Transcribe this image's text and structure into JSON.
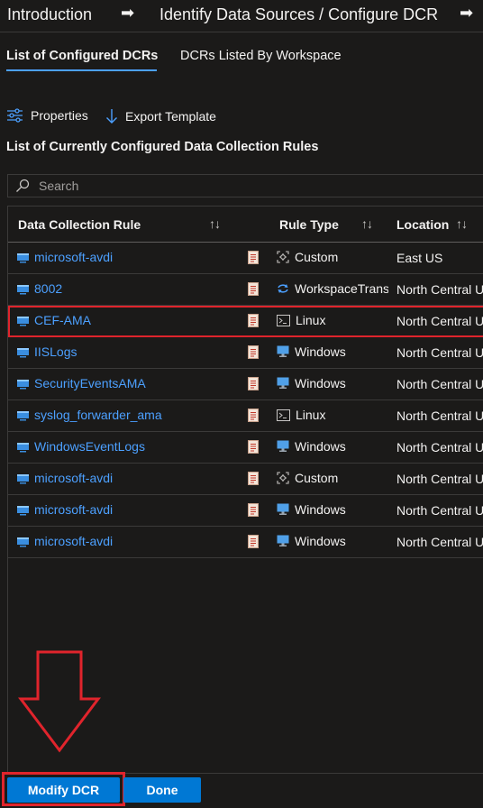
{
  "wizard": {
    "steps": [
      "Introduction",
      "Identify Data Sources / Configure DCR"
    ],
    "arrow": "➡"
  },
  "tabs": [
    {
      "label": "List of Configured DCRs",
      "active": true
    },
    {
      "label": "DCRs Listed By Workspace",
      "active": false
    }
  ],
  "toolbar": {
    "properties_label": "Properties",
    "properties_icon": "sliders-icon",
    "export_label": "Export Template",
    "export_icon": "download-arrow-icon"
  },
  "section_title": "List of Currently Configured Data Collection Rules",
  "search": {
    "placeholder": "Search",
    "value": ""
  },
  "table": {
    "columns": [
      "Data Collection Rule",
      "Rule Type",
      "Location"
    ],
    "sort_glyph": "↑↓",
    "rows": [
      {
        "rule": "microsoft-avdi",
        "type": "Custom",
        "type_icon": "custom-icon",
        "location": "East US"
      },
      {
        "rule": "8002",
        "type": "WorkspaceTransforms",
        "type_icon": "transform-icon",
        "location": "North Central US"
      },
      {
        "rule": "CEF-AMA",
        "type": "Linux",
        "type_icon": "terminal-icon",
        "location": "North Central US"
      },
      {
        "rule": "IISLogs",
        "type": "Windows",
        "type_icon": "monitor-icon",
        "location": "North Central US"
      },
      {
        "rule": "SecurityEventsAMA",
        "type": "Windows",
        "type_icon": "monitor-icon",
        "location": "North Central US"
      },
      {
        "rule": "syslog_forwarder_ama",
        "type": "Linux",
        "type_icon": "terminal-icon",
        "location": "North Central US"
      },
      {
        "rule": "WindowsEventLogs",
        "type": "Windows",
        "type_icon": "monitor-icon",
        "location": "North Central US"
      },
      {
        "rule": "microsoft-avdi",
        "type": "Custom",
        "type_icon": "custom-icon",
        "location": "North Central US"
      },
      {
        "rule": "microsoft-avdi",
        "type": "Windows",
        "type_icon": "monitor-icon",
        "location": "North Central US"
      },
      {
        "rule": "microsoft-avdi",
        "type": "Windows",
        "type_icon": "monitor-icon",
        "location": "North Central US"
      }
    ]
  },
  "footer": {
    "modify_label": "Modify DCR",
    "done_label": "Done"
  },
  "colors": {
    "accent": "#0078d4",
    "link": "#4ca0ff",
    "highlight": "#e0242c",
    "background": "#1b1a19"
  }
}
